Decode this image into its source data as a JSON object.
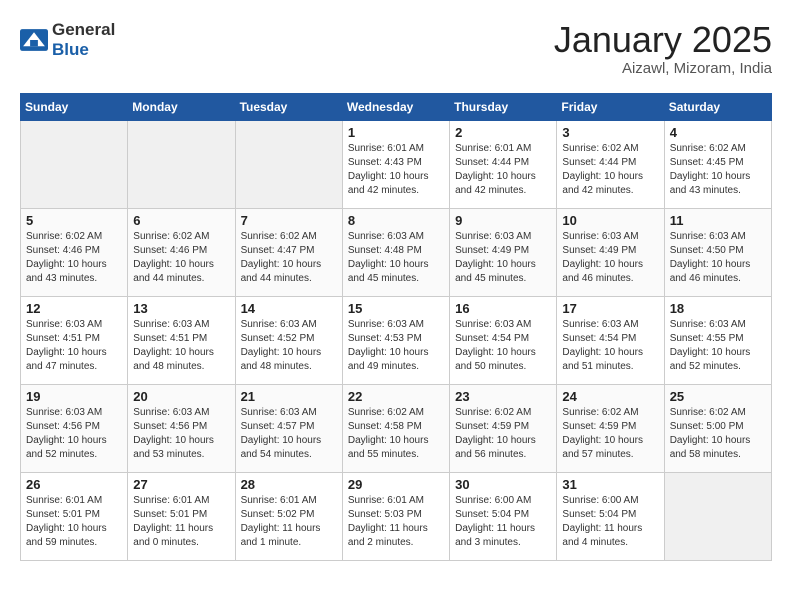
{
  "header": {
    "logo_general": "General",
    "logo_blue": "Blue",
    "month_title": "January 2025",
    "location": "Aizawl, Mizoram, India"
  },
  "days_of_week": [
    "Sunday",
    "Monday",
    "Tuesday",
    "Wednesday",
    "Thursday",
    "Friday",
    "Saturday"
  ],
  "weeks": [
    [
      {
        "day": "",
        "info": ""
      },
      {
        "day": "",
        "info": ""
      },
      {
        "day": "",
        "info": ""
      },
      {
        "day": "1",
        "info": "Sunrise: 6:01 AM\nSunset: 4:43 PM\nDaylight: 10 hours\nand 42 minutes."
      },
      {
        "day": "2",
        "info": "Sunrise: 6:01 AM\nSunset: 4:44 PM\nDaylight: 10 hours\nand 42 minutes."
      },
      {
        "day": "3",
        "info": "Sunrise: 6:02 AM\nSunset: 4:44 PM\nDaylight: 10 hours\nand 42 minutes."
      },
      {
        "day": "4",
        "info": "Sunrise: 6:02 AM\nSunset: 4:45 PM\nDaylight: 10 hours\nand 43 minutes."
      }
    ],
    [
      {
        "day": "5",
        "info": "Sunrise: 6:02 AM\nSunset: 4:46 PM\nDaylight: 10 hours\nand 43 minutes."
      },
      {
        "day": "6",
        "info": "Sunrise: 6:02 AM\nSunset: 4:46 PM\nDaylight: 10 hours\nand 44 minutes."
      },
      {
        "day": "7",
        "info": "Sunrise: 6:02 AM\nSunset: 4:47 PM\nDaylight: 10 hours\nand 44 minutes."
      },
      {
        "day": "8",
        "info": "Sunrise: 6:03 AM\nSunset: 4:48 PM\nDaylight: 10 hours\nand 45 minutes."
      },
      {
        "day": "9",
        "info": "Sunrise: 6:03 AM\nSunset: 4:49 PM\nDaylight: 10 hours\nand 45 minutes."
      },
      {
        "day": "10",
        "info": "Sunrise: 6:03 AM\nSunset: 4:49 PM\nDaylight: 10 hours\nand 46 minutes."
      },
      {
        "day": "11",
        "info": "Sunrise: 6:03 AM\nSunset: 4:50 PM\nDaylight: 10 hours\nand 46 minutes."
      }
    ],
    [
      {
        "day": "12",
        "info": "Sunrise: 6:03 AM\nSunset: 4:51 PM\nDaylight: 10 hours\nand 47 minutes."
      },
      {
        "day": "13",
        "info": "Sunrise: 6:03 AM\nSunset: 4:51 PM\nDaylight: 10 hours\nand 48 minutes."
      },
      {
        "day": "14",
        "info": "Sunrise: 6:03 AM\nSunset: 4:52 PM\nDaylight: 10 hours\nand 48 minutes."
      },
      {
        "day": "15",
        "info": "Sunrise: 6:03 AM\nSunset: 4:53 PM\nDaylight: 10 hours\nand 49 minutes."
      },
      {
        "day": "16",
        "info": "Sunrise: 6:03 AM\nSunset: 4:54 PM\nDaylight: 10 hours\nand 50 minutes."
      },
      {
        "day": "17",
        "info": "Sunrise: 6:03 AM\nSunset: 4:54 PM\nDaylight: 10 hours\nand 51 minutes."
      },
      {
        "day": "18",
        "info": "Sunrise: 6:03 AM\nSunset: 4:55 PM\nDaylight: 10 hours\nand 52 minutes."
      }
    ],
    [
      {
        "day": "19",
        "info": "Sunrise: 6:03 AM\nSunset: 4:56 PM\nDaylight: 10 hours\nand 52 minutes."
      },
      {
        "day": "20",
        "info": "Sunrise: 6:03 AM\nSunset: 4:56 PM\nDaylight: 10 hours\nand 53 minutes."
      },
      {
        "day": "21",
        "info": "Sunrise: 6:03 AM\nSunset: 4:57 PM\nDaylight: 10 hours\nand 54 minutes."
      },
      {
        "day": "22",
        "info": "Sunrise: 6:02 AM\nSunset: 4:58 PM\nDaylight: 10 hours\nand 55 minutes."
      },
      {
        "day": "23",
        "info": "Sunrise: 6:02 AM\nSunset: 4:59 PM\nDaylight: 10 hours\nand 56 minutes."
      },
      {
        "day": "24",
        "info": "Sunrise: 6:02 AM\nSunset: 4:59 PM\nDaylight: 10 hours\nand 57 minutes."
      },
      {
        "day": "25",
        "info": "Sunrise: 6:02 AM\nSunset: 5:00 PM\nDaylight: 10 hours\nand 58 minutes."
      }
    ],
    [
      {
        "day": "26",
        "info": "Sunrise: 6:01 AM\nSunset: 5:01 PM\nDaylight: 10 hours\nand 59 minutes."
      },
      {
        "day": "27",
        "info": "Sunrise: 6:01 AM\nSunset: 5:01 PM\nDaylight: 11 hours\nand 0 minutes."
      },
      {
        "day": "28",
        "info": "Sunrise: 6:01 AM\nSunset: 5:02 PM\nDaylight: 11 hours\nand 1 minute."
      },
      {
        "day": "29",
        "info": "Sunrise: 6:01 AM\nSunset: 5:03 PM\nDaylight: 11 hours\nand 2 minutes."
      },
      {
        "day": "30",
        "info": "Sunrise: 6:00 AM\nSunset: 5:04 PM\nDaylight: 11 hours\nand 3 minutes."
      },
      {
        "day": "31",
        "info": "Sunrise: 6:00 AM\nSunset: 5:04 PM\nDaylight: 11 hours\nand 4 minutes."
      },
      {
        "day": "",
        "info": ""
      }
    ]
  ]
}
